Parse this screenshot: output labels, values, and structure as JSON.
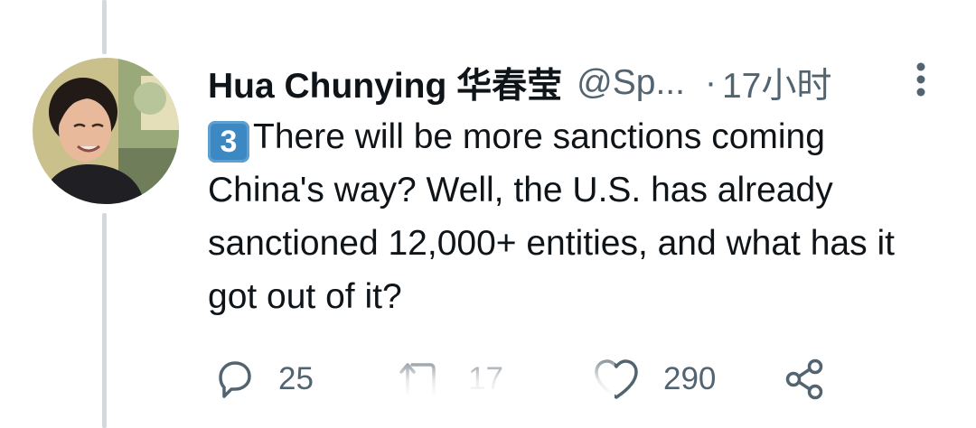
{
  "tweet": {
    "author_name": "Hua Chunying 华春莹",
    "handle": "@Sp...",
    "separator": "·",
    "timestamp": "17小时",
    "keycap": "3",
    "text": "There will be more sanctions coming China's way? Well, the U.S. has already sanctioned 12,000+ entities, and what has it got out of it?"
  },
  "actions": {
    "replies": "25",
    "retweets": "17",
    "likes": "290"
  },
  "icons": {
    "avatar": "profile-photo",
    "keycap": "keycap-3-emoji",
    "more": "more-vertical-icon",
    "reply": "reply-icon",
    "retweet": "retweet-icon",
    "like": "heart-icon",
    "share": "share-icon"
  },
  "colors": {
    "text": "#0f1419",
    "secondary": "#536471",
    "thread_line": "#cfd9de",
    "keycap_blue": "#3b88c3"
  }
}
